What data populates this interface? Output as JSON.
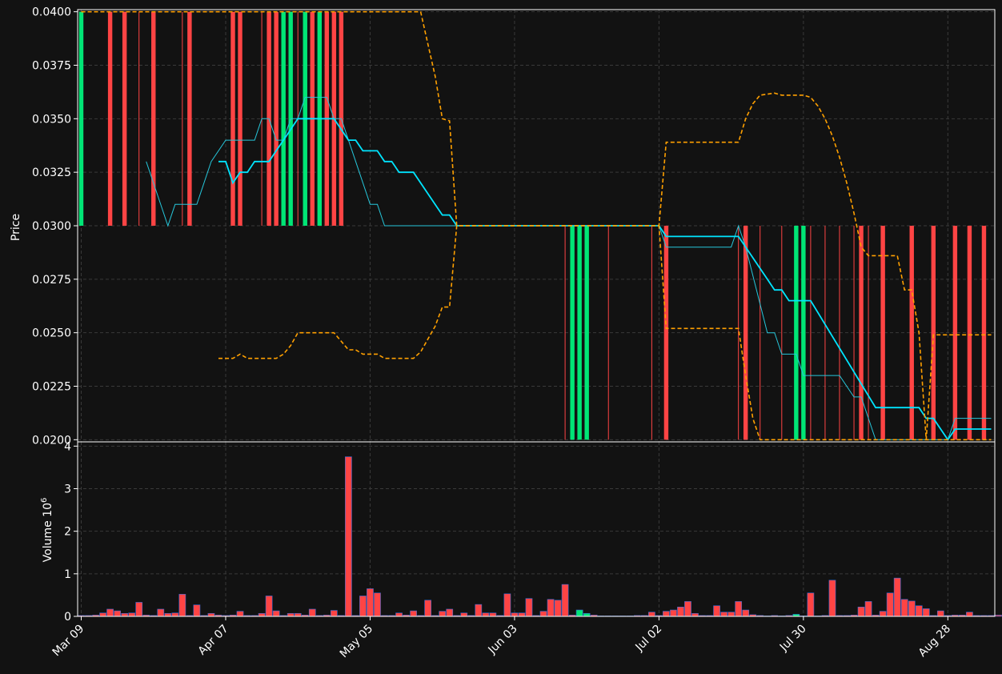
{
  "chart_data": [
    {
      "type": "candlestick",
      "ylabel": "Price",
      "ylim": [
        0.0199,
        0.0401
      ],
      "y_ticks": [
        "0.0200",
        "0.0225",
        "0.0250",
        "0.0275",
        "0.0300",
        "0.0325",
        "0.0350",
        "0.0375",
        "0.0400"
      ],
      "x_tick_labels": [
        "Mar 09",
        "Apr 07",
        "May 05",
        "Jun 03",
        "Jul 02",
        "Jul 30",
        "Aug 28"
      ],
      "x_tick_days": [
        0,
        20,
        40,
        60,
        80,
        100,
        120
      ],
      "x_range": [
        -0.5,
        126.5
      ],
      "grid": true,
      "colors": {
        "up": "#00e676",
        "down": "#ff4444",
        "ma_fast": "#00e5ff",
        "ma_slow": "#26c6da",
        "band": "#ffa000",
        "background": "#121212"
      },
      "candles": [
        {
          "day": 0,
          "dir": "up",
          "o": 0.03,
          "c": 0.04
        },
        {
          "day": 4,
          "dir": "down",
          "o": 0.04,
          "c": 0.03
        },
        {
          "day": 6,
          "dir": "down",
          "o": 0.04,
          "c": 0.03
        },
        {
          "day": 8,
          "dir": "thin",
          "o": 0.04,
          "c": 0.03
        },
        {
          "day": 10,
          "dir": "down",
          "o": 0.04,
          "c": 0.03
        },
        {
          "day": 14,
          "dir": "thin",
          "o": 0.04,
          "c": 0.03
        },
        {
          "day": 15,
          "dir": "down",
          "o": 0.04,
          "c": 0.03
        },
        {
          "day": 21,
          "dir": "down",
          "o": 0.04,
          "c": 0.03
        },
        {
          "day": 22,
          "dir": "down",
          "o": 0.04,
          "c": 0.03
        },
        {
          "day": 25,
          "dir": "thin",
          "o": 0.04,
          "c": 0.03
        },
        {
          "day": 26,
          "dir": "down",
          "o": 0.04,
          "c": 0.03
        },
        {
          "day": 27,
          "dir": "down",
          "o": 0.04,
          "c": 0.03
        },
        {
          "day": 28,
          "dir": "up",
          "o": 0.03,
          "c": 0.04
        },
        {
          "day": 29,
          "dir": "up",
          "o": 0.03,
          "c": 0.04
        },
        {
          "day": 30,
          "dir": "thin",
          "o": 0.04,
          "c": 0.03
        },
        {
          "day": 31,
          "dir": "up",
          "o": 0.03,
          "c": 0.04
        },
        {
          "day": 32,
          "dir": "down",
          "o": 0.04,
          "c": 0.03
        },
        {
          "day": 33,
          "dir": "up",
          "o": 0.03,
          "c": 0.04
        },
        {
          "day": 34,
          "dir": "down",
          "o": 0.04,
          "c": 0.03
        },
        {
          "day": 35,
          "dir": "down",
          "o": 0.04,
          "c": 0.03
        },
        {
          "day": 36,
          "dir": "down",
          "o": 0.04,
          "c": 0.03
        },
        {
          "day": 67,
          "dir": "thin",
          "o": 0.03,
          "c": 0.02
        },
        {
          "day": 68,
          "dir": "up",
          "o": 0.02,
          "c": 0.03
        },
        {
          "day": 69,
          "dir": "up",
          "o": 0.02,
          "c": 0.03
        },
        {
          "day": 70,
          "dir": "up",
          "o": 0.02,
          "c": 0.03
        },
        {
          "day": 73,
          "dir": "thin",
          "o": 0.03,
          "c": 0.02
        },
        {
          "day": 79,
          "dir": "thin",
          "o": 0.03,
          "c": 0.02
        },
        {
          "day": 81,
          "dir": "down",
          "o": 0.03,
          "c": 0.02
        },
        {
          "day": 91,
          "dir": "thin",
          "o": 0.03,
          "c": 0.02
        },
        {
          "day": 92,
          "dir": "down",
          "o": 0.03,
          "c": 0.02
        },
        {
          "day": 94,
          "dir": "thin",
          "o": 0.03,
          "c": 0.02
        },
        {
          "day": 97,
          "dir": "thin",
          "o": 0.03,
          "c": 0.02
        },
        {
          "day": 99,
          "dir": "up",
          "o": 0.02,
          "c": 0.03
        },
        {
          "day": 100,
          "dir": "up",
          "o": 0.02,
          "c": 0.03
        },
        {
          "day": 101,
          "dir": "thin",
          "o": 0.03,
          "c": 0.02
        },
        {
          "day": 103,
          "dir": "thin",
          "o": 0.03,
          "c": 0.02
        },
        {
          "day": 105,
          "dir": "thin",
          "o": 0.03,
          "c": 0.02
        },
        {
          "day": 107,
          "dir": "thin",
          "o": 0.03,
          "c": 0.02
        },
        {
          "day": 108,
          "dir": "down",
          "o": 0.03,
          "c": 0.02
        },
        {
          "day": 109,
          "dir": "thin",
          "o": 0.03,
          "c": 0.02
        },
        {
          "day": 111,
          "dir": "down",
          "o": 0.03,
          "c": 0.02
        },
        {
          "day": 115,
          "dir": "down",
          "o": 0.03,
          "c": 0.02
        },
        {
          "day": 118,
          "dir": "down",
          "o": 0.03,
          "c": 0.02
        },
        {
          "day": 121,
          "dir": "down",
          "o": 0.03,
          "c": 0.02
        },
        {
          "day": 123,
          "dir": "down",
          "o": 0.03,
          "c": 0.02
        },
        {
          "day": 125,
          "dir": "down",
          "o": 0.03,
          "c": 0.02
        }
      ],
      "ma_fast": [
        [
          19,
          0.033
        ],
        [
          20,
          0.033
        ],
        [
          21,
          0.032
        ],
        [
          22,
          0.0325
        ],
        [
          23,
          0.0325
        ],
        [
          24,
          0.033
        ],
        [
          26,
          0.033
        ],
        [
          27,
          0.0335
        ],
        [
          28,
          0.034
        ],
        [
          29,
          0.0345
        ],
        [
          30,
          0.035
        ],
        [
          35,
          0.035
        ],
        [
          37,
          0.034
        ],
        [
          38,
          0.034
        ],
        [
          39,
          0.0335
        ],
        [
          41,
          0.0335
        ],
        [
          42,
          0.033
        ],
        [
          43,
          0.033
        ],
        [
          44,
          0.0325
        ],
        [
          46,
          0.0325
        ],
        [
          48,
          0.0315
        ],
        [
          50,
          0.0305
        ],
        [
          51,
          0.0305
        ],
        [
          52,
          0.03
        ],
        [
          80,
          0.03
        ],
        [
          81,
          0.0295
        ],
        [
          91,
          0.0295
        ],
        [
          95,
          0.0275
        ],
        [
          96,
          0.027
        ],
        [
          97,
          0.027
        ],
        [
          98,
          0.0265
        ],
        [
          101,
          0.0265
        ],
        [
          110,
          0.0215
        ],
        [
          116,
          0.0215
        ],
        [
          117,
          0.021
        ],
        [
          118,
          0.021
        ],
        [
          120,
          0.02
        ],
        [
          121,
          0.0205
        ],
        [
          126,
          0.0205
        ]
      ],
      "ma_slow": [
        [
          9,
          0.033
        ],
        [
          12,
          0.03
        ],
        [
          13,
          0.031
        ],
        [
          16,
          0.031
        ],
        [
          18,
          0.033
        ],
        [
          20,
          0.034
        ],
        [
          24,
          0.034
        ],
        [
          25,
          0.035
        ],
        [
          26,
          0.035
        ],
        [
          27,
          0.034
        ],
        [
          28,
          0.034
        ],
        [
          29,
          0.035
        ],
        [
          30,
          0.035
        ],
        [
          31,
          0.036
        ],
        [
          34,
          0.036
        ],
        [
          35,
          0.035
        ],
        [
          36,
          0.035
        ],
        [
          40,
          0.031
        ],
        [
          41,
          0.031
        ],
        [
          42,
          0.03
        ],
        [
          80,
          0.03
        ],
        [
          81,
          0.029
        ],
        [
          90,
          0.029
        ],
        [
          91,
          0.03
        ],
        [
          92,
          0.029
        ],
        [
          95,
          0.025
        ],
        [
          96,
          0.025
        ],
        [
          97,
          0.024
        ],
        [
          99,
          0.024
        ],
        [
          100,
          0.023
        ],
        [
          105,
          0.023
        ],
        [
          107,
          0.022
        ],
        [
          108,
          0.022
        ],
        [
          110,
          0.02
        ],
        [
          120,
          0.02
        ],
        [
          121,
          0.021
        ],
        [
          126,
          0.021
        ]
      ],
      "band_upper": [
        [
          0,
          0.04
        ],
        [
          47,
          0.04
        ],
        [
          48,
          0.0385
        ],
        [
          49,
          0.037
        ],
        [
          50,
          0.035
        ],
        [
          51,
          0.0349
        ],
        [
          52,
          0.03
        ],
        [
          80,
          0.03
        ],
        [
          81,
          0.0339
        ],
        [
          91,
          0.0339
        ],
        [
          92,
          0.035
        ],
        [
          93,
          0.0357
        ],
        [
          94,
          0.0361
        ],
        [
          96,
          0.0362
        ],
        [
          97,
          0.0361
        ],
        [
          100,
          0.0361
        ],
        [
          101,
          0.036
        ],
        [
          102,
          0.0356
        ],
        [
          103,
          0.035
        ],
        [
          104,
          0.0342
        ],
        [
          105,
          0.0332
        ],
        [
          106,
          0.032
        ],
        [
          107,
          0.0306
        ],
        [
          108,
          0.029
        ],
        [
          109,
          0.0286
        ],
        [
          113,
          0.0286
        ],
        [
          114,
          0.027
        ],
        [
          115,
          0.027
        ],
        [
          116,
          0.025
        ],
        [
          117,
          0.02
        ],
        [
          118,
          0.0249
        ],
        [
          126,
          0.0249
        ]
      ],
      "band_lower": [
        [
          19,
          0.0238
        ],
        [
          21,
          0.0238
        ],
        [
          22,
          0.024
        ],
        [
          23,
          0.0238
        ],
        [
          27,
          0.0238
        ],
        [
          28,
          0.024
        ],
        [
          29,
          0.0244
        ],
        [
          30,
          0.025
        ],
        [
          35,
          0.025
        ],
        [
          36,
          0.0246
        ],
        [
          37,
          0.0242
        ],
        [
          38,
          0.0242
        ],
        [
          39,
          0.024
        ],
        [
          41,
          0.024
        ],
        [
          42,
          0.0238
        ],
        [
          46,
          0.0238
        ],
        [
          47,
          0.0241
        ],
        [
          48,
          0.0247
        ],
        [
          49,
          0.0253
        ],
        [
          50,
          0.0262
        ],
        [
          51,
          0.0262
        ],
        [
          52,
          0.03
        ],
        [
          80,
          0.03
        ],
        [
          81,
          0.0252
        ],
        [
          90,
          0.0252
        ],
        [
          91,
          0.0252
        ],
        [
          92,
          0.023
        ],
        [
          93,
          0.021
        ],
        [
          94,
          0.02
        ],
        [
          126,
          0.02
        ]
      ]
    },
    {
      "type": "bar",
      "ylabel": "Volume  10",
      "ylabel_exp": "6",
      "ylim": [
        0,
        4.1
      ],
      "y_ticks": [
        "0",
        "1",
        "2",
        "3",
        "4"
      ],
      "values": [
        0.02,
        0.02,
        0.03,
        0.08,
        0.17,
        0.13,
        0.07,
        0.08,
        0.33,
        0.03,
        0.02,
        0.17,
        0.07,
        0.08,
        0.52,
        0.02,
        0.27,
        0.02,
        0.07,
        0.03,
        0.02,
        0.03,
        0.12,
        0.02,
        0.02,
        0.07,
        0.48,
        0.13,
        0.02,
        0.07,
        0.07,
        0.03,
        0.17,
        0.02,
        0.03,
        0.14,
        0.02,
        3.75,
        0.02,
        0.48,
        0.65,
        0.55,
        0.02,
        0.02,
        0.08,
        0.03,
        0.13,
        0.02,
        0.38,
        0.02,
        0.12,
        0.17,
        0.02,
        0.08,
        0.02,
        0.28,
        0.08,
        0.08,
        0.02,
        0.53,
        0.08,
        0.08,
        0.42,
        0.02,
        0.12,
        0.4,
        0.38,
        0.75,
        0.03,
        0.15,
        0.07,
        0.03,
        0.01,
        0.01,
        0.01,
        0.01,
        0.01,
        0.02,
        0.02,
        0.1,
        0.02,
        0.12,
        0.15,
        0.22,
        0.35,
        0.07,
        0.02,
        0.02,
        0.25,
        0.1,
        0.1,
        0.35,
        0.15,
        0.04,
        0.02,
        0.01,
        0.02,
        0.01,
        0.02,
        0.05,
        0.01,
        0.55,
        0.01,
        0.02,
        0.85,
        0.02,
        0.02,
        0.03,
        0.22,
        0.35,
        0.03,
        0.12,
        0.55,
        0.9,
        0.4,
        0.36,
        0.25,
        0.18,
        0.02,
        0.13,
        0.02,
        0.03,
        0.03,
        0.1,
        0.02,
        0.02,
        0.02,
        0.03
      ],
      "up_days": [
        69,
        70,
        99
      ]
    }
  ]
}
